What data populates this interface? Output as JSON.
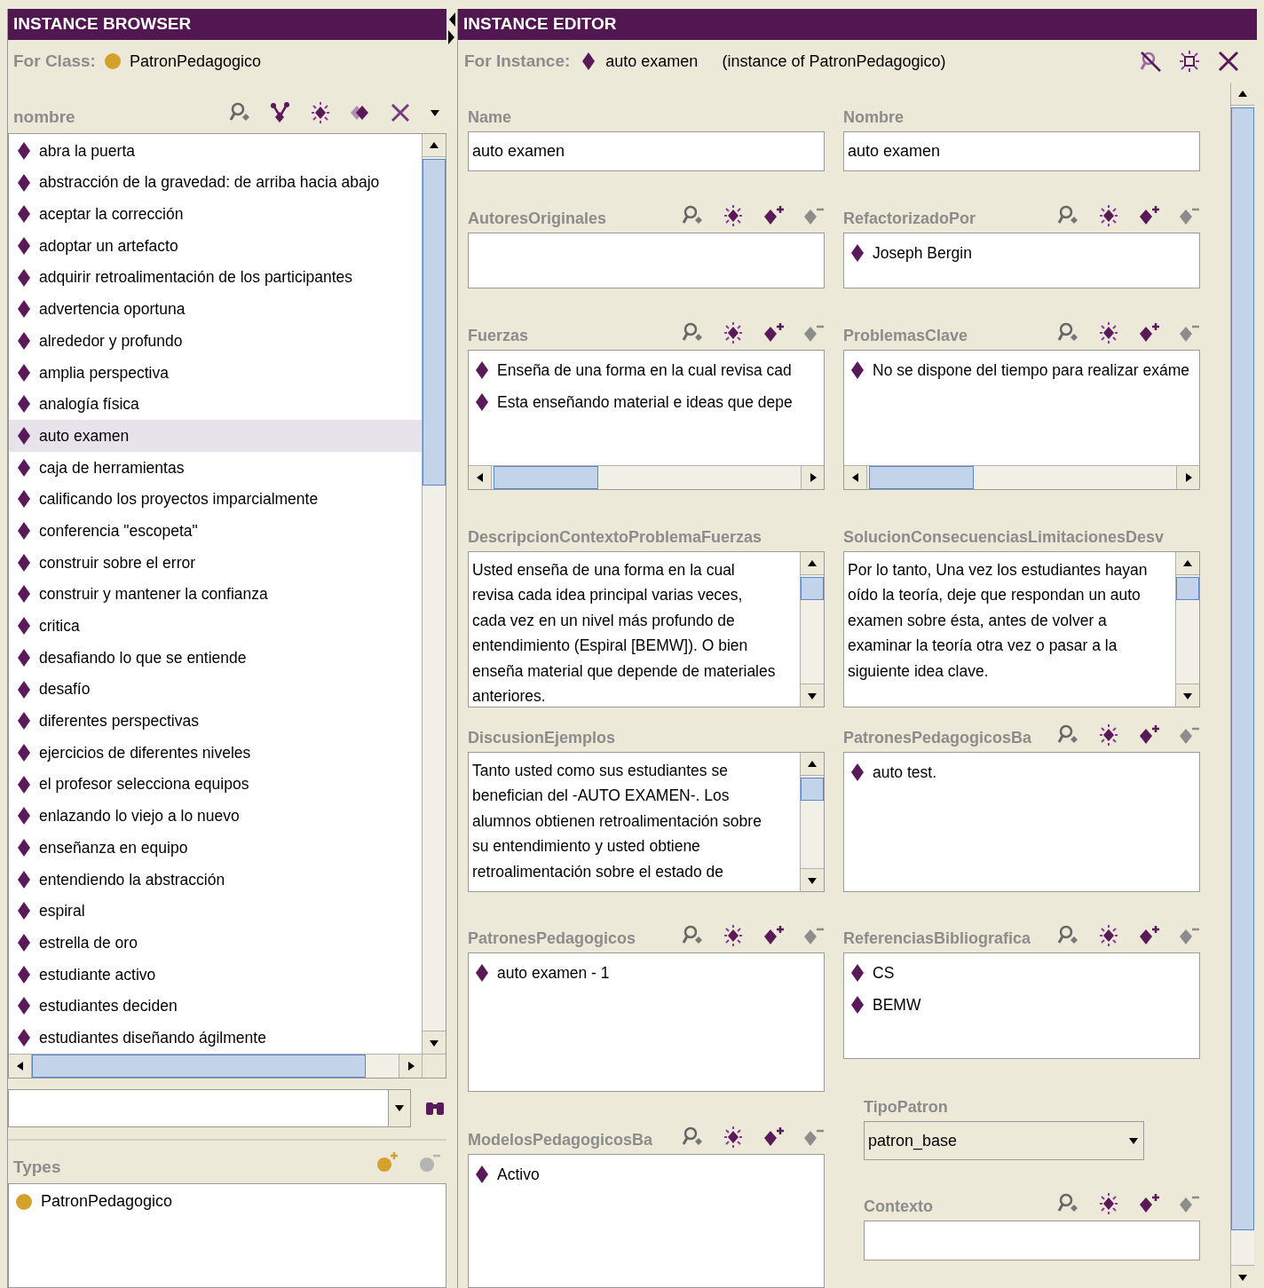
{
  "browser": {
    "title": "INSTANCE BROWSER",
    "for_class": {
      "label": "For Class:",
      "value": "PatronPedagogico"
    },
    "list": {
      "header": "nombre",
      "items": [
        {
          "label": "abra la puerta",
          "selected": false
        },
        {
          "label": "abstracción de la gravedad: de arriba hacia abajo",
          "selected": false
        },
        {
          "label": "aceptar la corrección",
          "selected": false
        },
        {
          "label": "adoptar un artefacto",
          "selected": false
        },
        {
          "label": "adquirir retroalimentación de los participantes",
          "selected": false
        },
        {
          "label": "advertencia oportuna",
          "selected": false
        },
        {
          "label": "alrededor y profundo",
          "selected": false
        },
        {
          "label": "amplia perspectiva",
          "selected": false
        },
        {
          "label": "analogía física",
          "selected": false
        },
        {
          "label": "auto examen",
          "selected": true
        },
        {
          "label": "caja de herramientas",
          "selected": false
        },
        {
          "label": "calificando los proyectos imparcialmente",
          "selected": false
        },
        {
          "label": "conferencia \"escopeta\"",
          "selected": false
        },
        {
          "label": "construir sobre el error",
          "selected": false
        },
        {
          "label": "construir y mantener la confianza",
          "selected": false
        },
        {
          "label": "critica",
          "selected": false
        },
        {
          "label": "desafiando lo que se entiende",
          "selected": false
        },
        {
          "label": "desafío",
          "selected": false
        },
        {
          "label": "diferentes perspectivas",
          "selected": false
        },
        {
          "label": "ejercicios de diferentes niveles",
          "selected": false
        },
        {
          "label": "el profesor selecciona equipos",
          "selected": false
        },
        {
          "label": "enlazando lo viejo a lo nuevo",
          "selected": false
        },
        {
          "label": "enseñanza en equipo",
          "selected": false
        },
        {
          "label": "entendiendo la abstracción",
          "selected": false
        },
        {
          "label": "espiral",
          "selected": false
        },
        {
          "label": "estrella de oro",
          "selected": false
        },
        {
          "label": "estudiante activo",
          "selected": false
        },
        {
          "label": "estudiantes deciden",
          "selected": false
        },
        {
          "label": "estudiantes diseñando ágilmente",
          "selected": false
        }
      ]
    },
    "types": {
      "header": "Types",
      "items": [
        {
          "label": "PatronPedagogico"
        }
      ]
    }
  },
  "editor": {
    "title": "INSTANCE EDITOR",
    "for_instance": {
      "label": "For Instance:",
      "value": "auto examen",
      "instance_of": "(instance of PatronPedagogico)"
    },
    "columns": [
      [
        {
          "label": "Name",
          "kind": "text",
          "value": "auto examen"
        },
        {
          "label": "AutoresOriginales",
          "kind": "list"
        },
        {
          "label": "Fuerzas",
          "kind": "scroll_list",
          "items": [
            "Enseña de una forma en la cual revisa cad",
            "Esta enseñando material e ideas que depe"
          ]
        },
        {
          "label": "DescripcionContextoProblemaFuerzas",
          "kind": "textarea",
          "value": "Usted enseña de una forma en la cual revisa cada idea principal varias veces, cada vez en un nivel más profundo de entendimiento (Espiral [BEMW]). O bien enseña material que depende de materiales anteriores."
        },
        {
          "label": "DiscusionEjemplos",
          "kind": "textarea",
          "value": "Tanto usted como sus estudiantes se benefician del -AUTO EXAMEN-. Los alumnos obtienen retroalimentación sobre su entendimiento y usted obtiene retroalimentación sobre el estado de"
        },
        {
          "label": "PatronesPedagogicos",
          "kind": "list",
          "items": [
            "auto examen - 1"
          ]
        },
        {
          "label": "ModelosPedagogicosBa",
          "kind": "list",
          "items": [
            "Activo"
          ]
        }
      ],
      [
        {
          "label": "Nombre",
          "kind": "text",
          "value": "auto examen"
        },
        {
          "label": "RefactorizadoPor",
          "kind": "list",
          "items": [
            "Joseph Bergin"
          ]
        },
        {
          "label": "ProblemasClave",
          "kind": "scroll_list",
          "items": [
            "No se dispone del tiempo para realizar exáme"
          ]
        },
        {
          "label": "SolucionConsecuenciasLimitacionesDesv",
          "kind": "textarea",
          "value": "Por lo tanto, Una vez los estudiantes hayan oído la teoría, deje que respondan un auto examen sobre ésta, antes de volver a examinar la teoría otra vez o pasar a la siguiente idea clave."
        },
        {
          "label": "PatronesPedagogicosBa",
          "kind": "list",
          "items": [
            "auto test."
          ]
        },
        {
          "label": "ReferenciasBibliografica",
          "kind": "list",
          "items": [
            "CS",
            "BEMW"
          ]
        },
        {
          "label": "TipoPatron",
          "kind": "dropdown",
          "value": "patron_base"
        },
        {
          "label": "Contexto",
          "kind": "list"
        }
      ]
    ]
  }
}
